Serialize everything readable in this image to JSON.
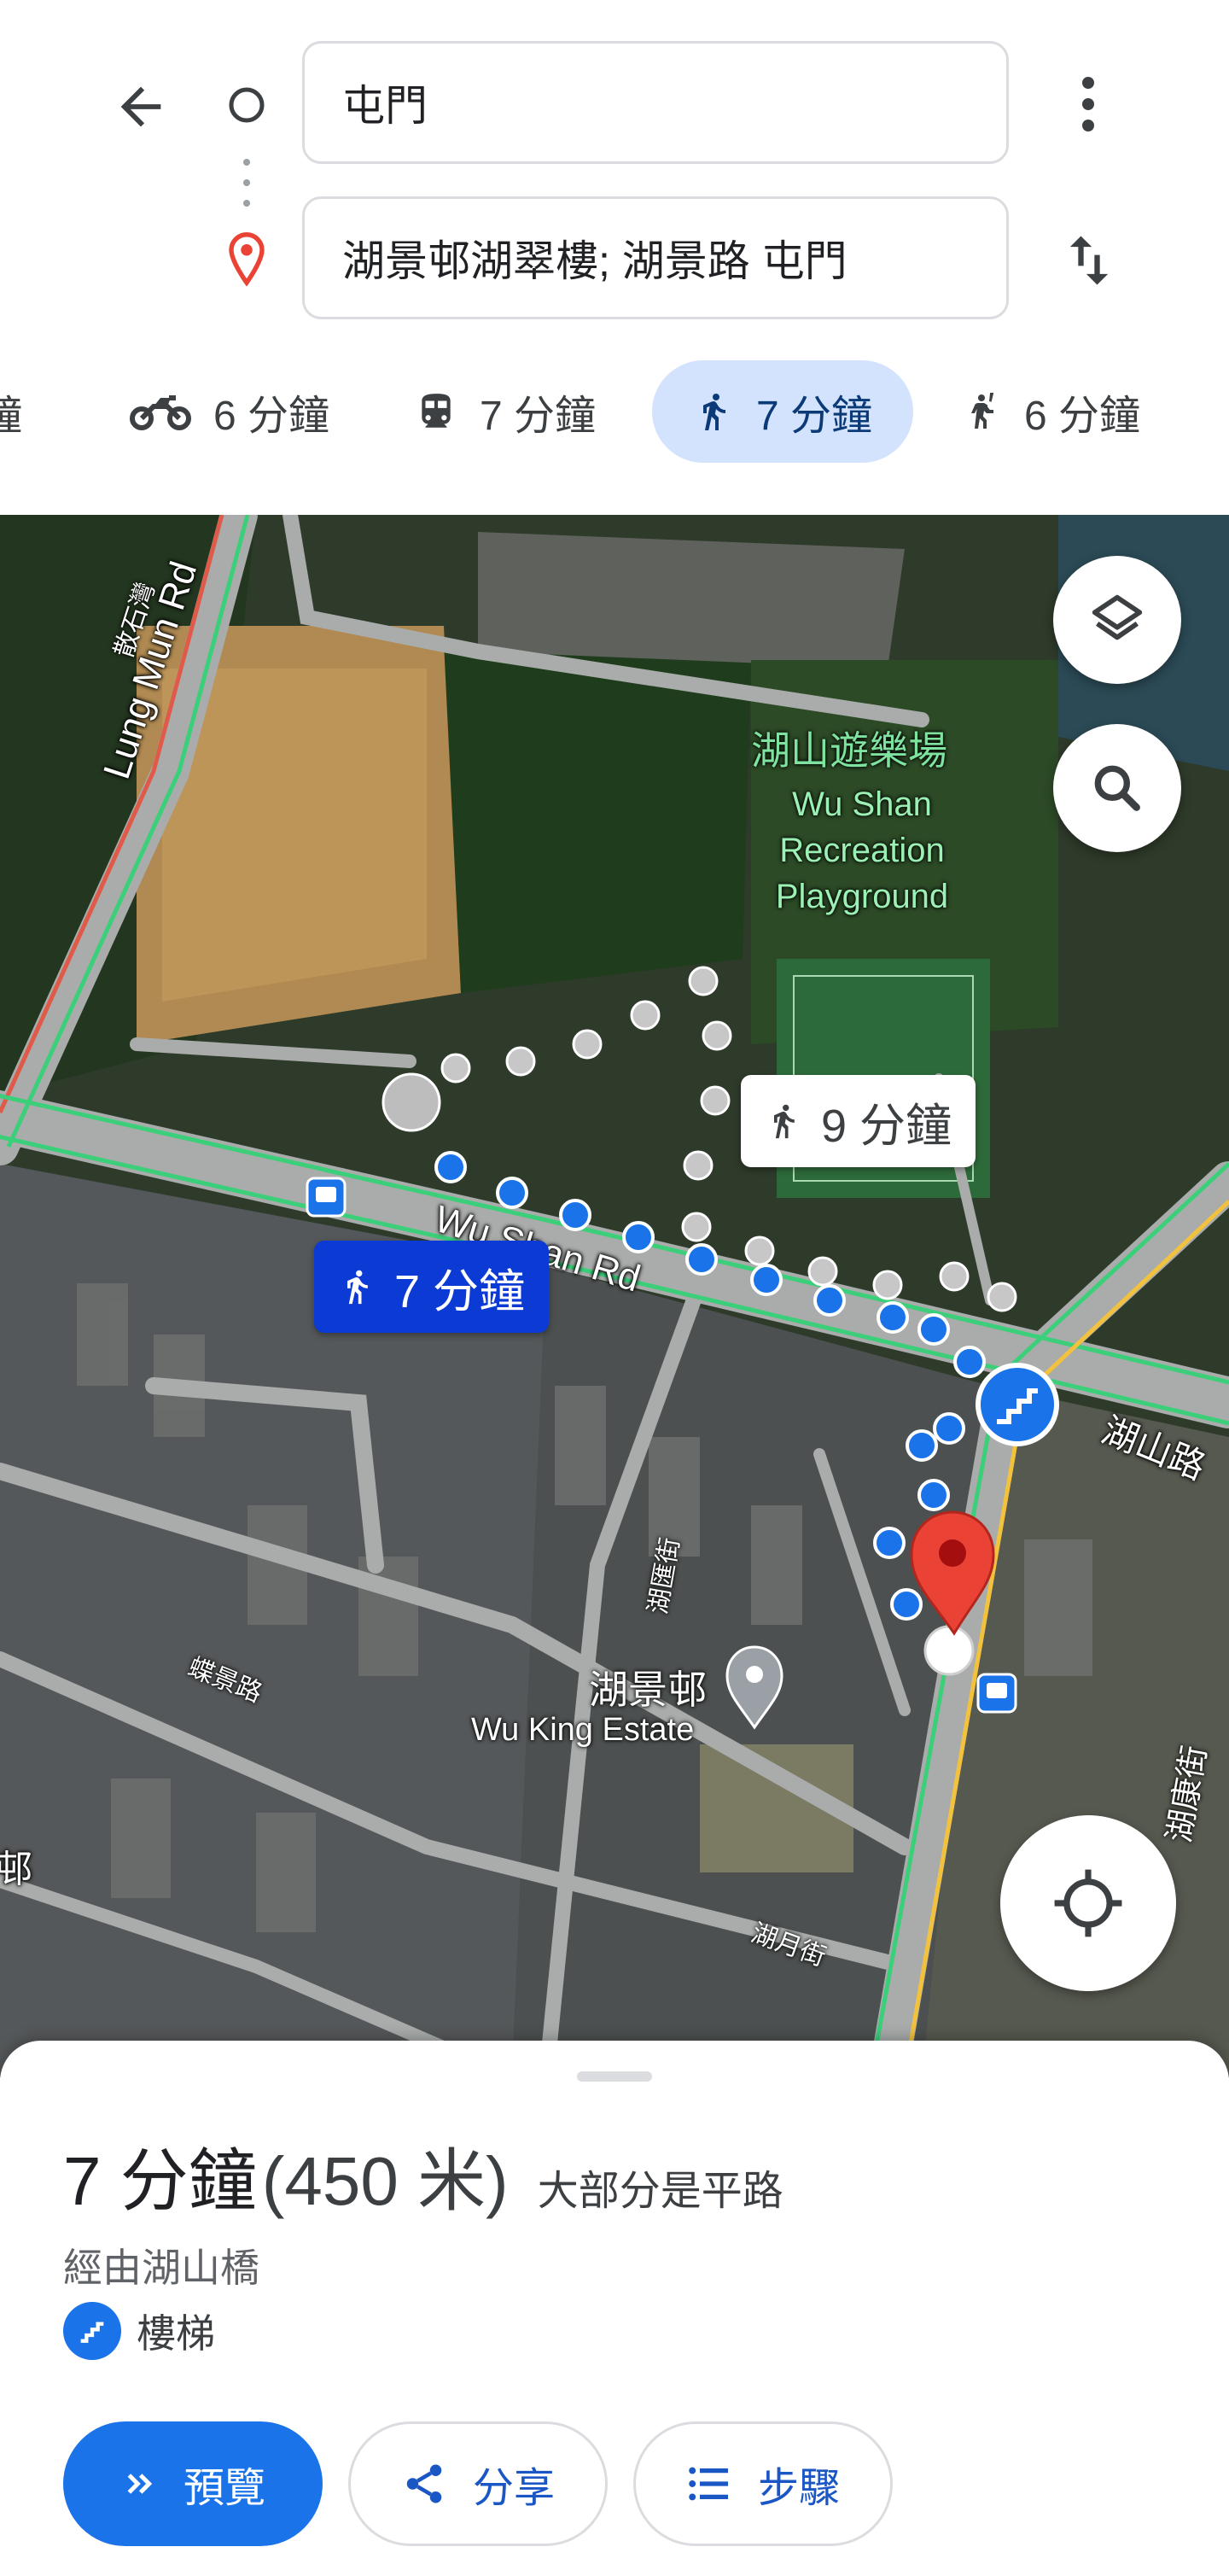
{
  "header": {
    "origin_value": "屯門",
    "destination_value": "湖景邨湖翠樓; 湖景路 屯門"
  },
  "modes": [
    {
      "id": "drive",
      "label": "分鐘",
      "icon": "car-icon"
    },
    {
      "id": "motorcycle",
      "label": "6 分鐘",
      "icon": "motorcycle-icon"
    },
    {
      "id": "transit",
      "label": "7 分鐘",
      "icon": "train-icon"
    },
    {
      "id": "walk",
      "label": "7 分鐘",
      "icon": "walk-icon",
      "selected": true
    },
    {
      "id": "ride",
      "label": "6 分鐘",
      "icon": "hail-icon"
    }
  ],
  "map": {
    "alt_route_label": "9 分鐘",
    "main_route_label": "7 分鐘",
    "park_name_zh": "湖山遊樂場",
    "park_name_en": "Wu Shan Recreation Playground",
    "estate_name_zh": "湖景邨",
    "estate_name_en": "Wu King Estate",
    "road_lung_mun": "Lung Mun Rd",
    "road_wu_shan": "Wu Shan Rd",
    "road_wu_shan_zh": "湖山路",
    "road_san_shek": "散石灣",
    "road_wu_hui": "湖匯街",
    "road_dip_king": "蝶景路",
    "road_wu_yuet": "湖月街",
    "road_wu_hong": "湖康街",
    "left_edge_label": "邨",
    "route_color": "#1a73e8",
    "alt_route_color": "#bdbdbd",
    "destination_color": "#ea4335"
  },
  "sheet": {
    "duration": "7 分鐘",
    "distance": "(450 米)",
    "terrain_note": "大部分是平路",
    "via": "經由湖山橋",
    "stairs_label": "樓梯",
    "preview_label": "預覽",
    "share_label": "分享",
    "steps_label": "步驟"
  }
}
